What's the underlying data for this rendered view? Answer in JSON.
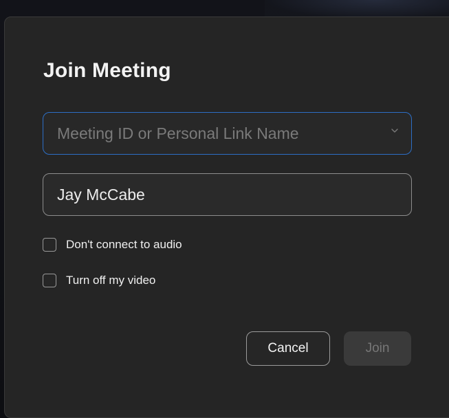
{
  "dialog": {
    "title": "Join Meeting",
    "meeting_field": {
      "placeholder": "Meeting ID or Personal Link Name",
      "value": "",
      "dropdown_icon": "chevron-down-icon"
    },
    "name_field": {
      "value": "Jay McCabe"
    },
    "options": [
      {
        "label": "Don't connect to audio",
        "checked": false
      },
      {
        "label": "Turn off my video",
        "checked": false
      }
    ],
    "buttons": {
      "cancel_label": "Cancel",
      "join_label": "Join"
    }
  },
  "colors": {
    "dialog_bg": "#252525",
    "focus_border": "#2d6fc7",
    "disabled_button_bg": "#3a3a3a"
  }
}
